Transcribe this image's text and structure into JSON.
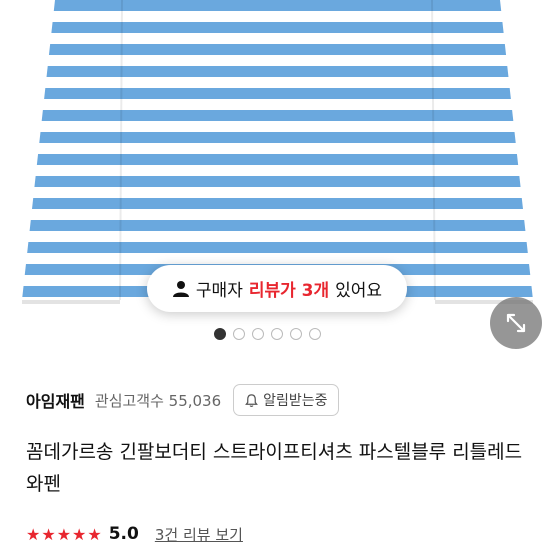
{
  "review_pill": {
    "prefix": "구매자",
    "highlight": "리뷰가 3개",
    "suffix": "있어요"
  },
  "carousel": {
    "total": 6,
    "active_index": 0
  },
  "shop": {
    "name": "아임재팬",
    "interest_label": "관심고객수 55,036",
    "alarm_label": "알림받는중"
  },
  "product": {
    "title": "꼼데가르송 긴팔보더티 스트라이프티셔츠 파스텔블루 리틀레드와펜"
  },
  "rating": {
    "stars": "★★★★★",
    "score": "5.0",
    "review_link": "3건 리뷰 보기"
  },
  "colors": {
    "stripe_blue": "#6aa8de",
    "accent_red": "#e8262f"
  },
  "icons": {
    "person": "person-icon",
    "expand": "expand-icon",
    "bell": "bell-icon"
  }
}
